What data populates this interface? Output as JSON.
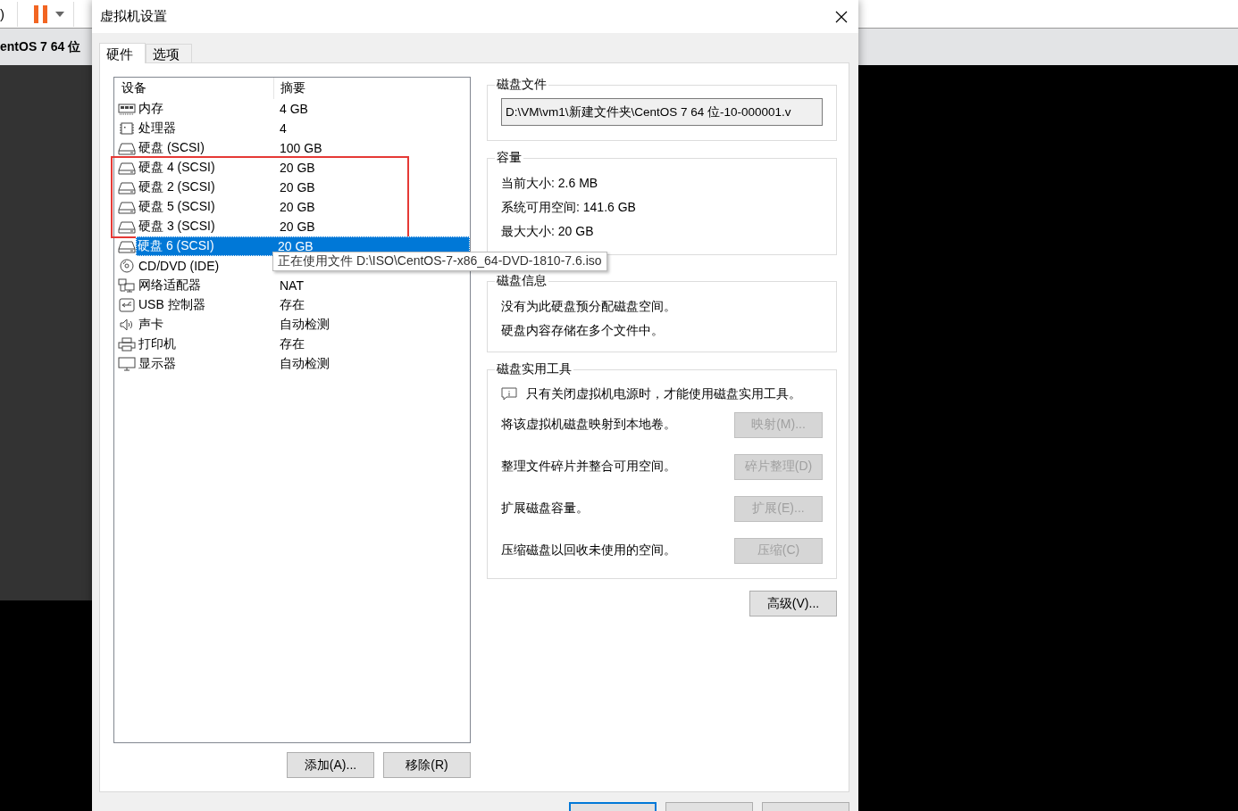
{
  "background_app": {
    "menu_fragment": ")",
    "tab_title": "entOS 7 64 位"
  },
  "window": {
    "title": "虚拟机设置"
  },
  "tabs": [
    {
      "label": "硬件",
      "selected": true
    },
    {
      "label": "选项",
      "selected": false
    }
  ],
  "device_table": {
    "columns": [
      "设备",
      "摘要"
    ],
    "rows": [
      {
        "kind": "memory",
        "device": "内存",
        "summary": "4 GB",
        "selected": false,
        "highlighted": false,
        "tooltip": false
      },
      {
        "kind": "processor",
        "device": "处理器",
        "summary": "4",
        "selected": false,
        "highlighted": false,
        "tooltip": false
      },
      {
        "kind": "disk",
        "device": "硬盘 (SCSI)",
        "summary": "100 GB",
        "selected": false,
        "highlighted": false,
        "tooltip": false
      },
      {
        "kind": "disk",
        "device": "硬盘 4 (SCSI)",
        "summary": "20 GB",
        "selected": false,
        "highlighted": true,
        "tooltip": false
      },
      {
        "kind": "disk",
        "device": "硬盘 2 (SCSI)",
        "summary": "20 GB",
        "selected": false,
        "highlighted": true,
        "tooltip": false
      },
      {
        "kind": "disk",
        "device": "硬盘 5 (SCSI)",
        "summary": "20 GB",
        "selected": false,
        "highlighted": true,
        "tooltip": false
      },
      {
        "kind": "disk",
        "device": "硬盘 3 (SCSI)",
        "summary": "20 GB",
        "selected": false,
        "highlighted": true,
        "tooltip": false
      },
      {
        "kind": "disk",
        "device": "硬盘 6 (SCSI)",
        "summary": "20 GB",
        "selected": true,
        "highlighted": false,
        "tooltip": false
      },
      {
        "kind": "cdrom",
        "device": "CD/DVD (IDE)",
        "summary": "正在使用文件 D:\\ISO\\CentOS-7-x86_64-DVD-1810-7.6.iso",
        "selected": false,
        "highlighted": false,
        "tooltip": true
      },
      {
        "kind": "network",
        "device": "网络适配器",
        "summary": "NAT",
        "selected": false,
        "highlighted": false,
        "tooltip": false
      },
      {
        "kind": "usb",
        "device": "USB 控制器",
        "summary": "存在",
        "selected": false,
        "highlighted": false,
        "tooltip": false
      },
      {
        "kind": "sound",
        "device": "声卡",
        "summary": "自动检测",
        "selected": false,
        "highlighted": false,
        "tooltip": false
      },
      {
        "kind": "printer",
        "device": "打印机",
        "summary": "存在",
        "selected": false,
        "highlighted": false,
        "tooltip": false
      },
      {
        "kind": "display",
        "device": "显示器",
        "summary": "自动检测",
        "selected": false,
        "highlighted": false,
        "tooltip": false
      }
    ]
  },
  "list_buttons": [
    "添加(A)...",
    "移除(R)"
  ],
  "disk_file": {
    "legend": "磁盘文件",
    "value": "D:\\VM\\vm1\\新建文件夹\\CentOS 7 64 位-10-000001.v"
  },
  "capacity": {
    "legend": "容量",
    "lines": [
      "当前大小: 2.6 MB",
      "系统可用空间: 141.6 GB",
      "最大大小: 20 GB"
    ]
  },
  "disk_info": {
    "legend": "磁盘信息",
    "lines": [
      "没有为此硬盘预分配磁盘空间。",
      "硬盘内容存储在多个文件中。"
    ]
  },
  "disk_utilities": {
    "legend": "磁盘实用工具",
    "notice": "只有关闭虚拟机电源时，才能使用磁盘实用工具。",
    "actions": [
      {
        "description": "将该虚拟机磁盘映射到本地卷。",
        "button": "映射(M)...",
        "disabled": true
      },
      {
        "description": "整理文件碎片并整合可用空间。",
        "button": "碎片整理(D)",
        "disabled": true
      },
      {
        "description": "扩展磁盘容量。",
        "button": "扩展(E)...",
        "disabled": true
      },
      {
        "description": "压缩磁盘以回收未使用的空间。",
        "button": "压缩(C)",
        "disabled": true
      }
    ]
  },
  "advanced_button": "高级(V)..."
}
